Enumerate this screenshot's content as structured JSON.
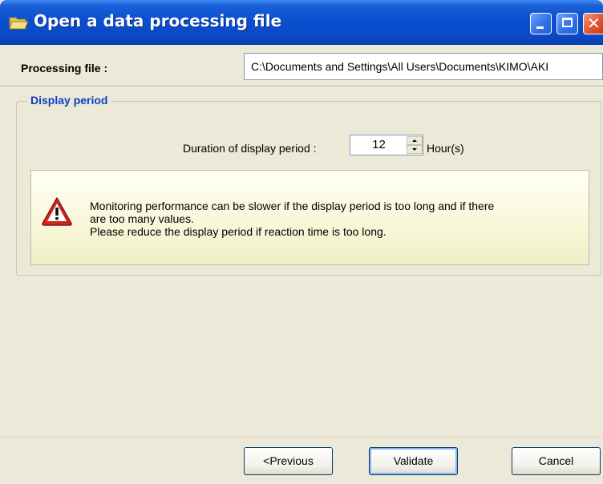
{
  "window": {
    "title": "Open a data processing file"
  },
  "file": {
    "label": "Processing file :",
    "path": "C:\\Documents and Settings\\All Users\\Documents\\KIMO\\AKI"
  },
  "display_period": {
    "legend": "Display period",
    "duration_label": "Duration of display period :",
    "duration_value": "12",
    "unit": "Hour(s)"
  },
  "warning": {
    "icon": "warning-triangle-icon",
    "lines": [
      "Monitoring performance can be slower if the display period is too long and if there",
      "are too many values.",
      "Please reduce the display period if reaction time is too long."
    ]
  },
  "buttons": {
    "previous": "<Previous",
    "validate": "Validate",
    "cancel": "Cancel"
  },
  "colors": {
    "titlebar": "#0a4fd0",
    "legend": "#0b3ec5",
    "warning_bg": "#f8f7d8",
    "dialog_bg": "#ece9d8"
  }
}
